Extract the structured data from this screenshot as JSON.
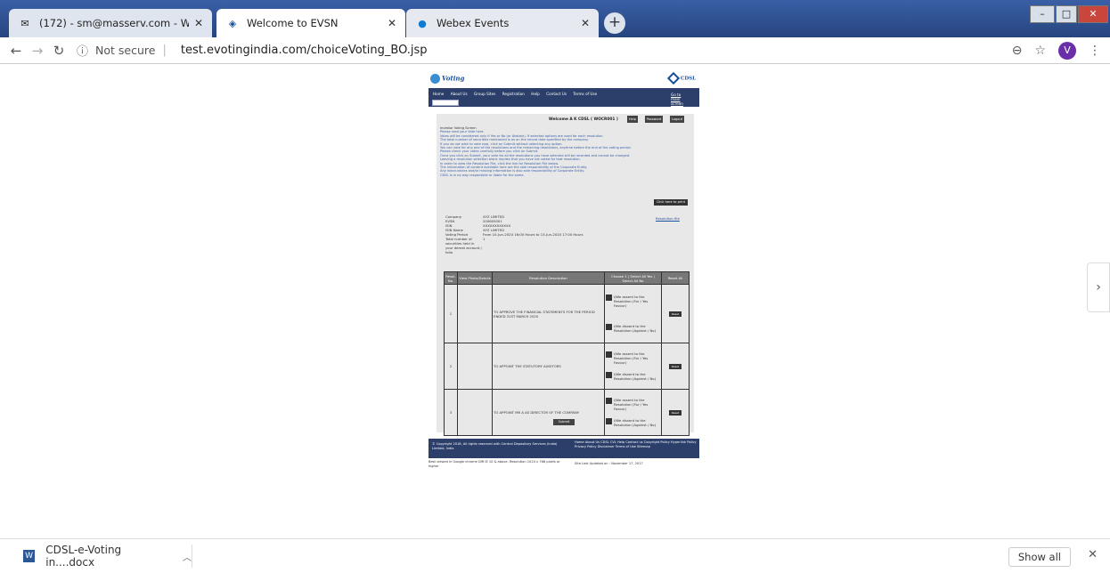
{
  "browser": {
    "tabs": [
      {
        "title": "(172) - sm@masserv.com - Web",
        "icon": "mail-icon"
      },
      {
        "title": "Welcome to EVSN",
        "icon": "cdsl-diamond-icon"
      },
      {
        "title": "Webex Events",
        "icon": "webex-icon"
      }
    ],
    "url_security": "Not secure",
    "url": "test.evotingindia.com/choiceVoting_BO.jsp",
    "profile_initial": "V"
  },
  "page": {
    "logo": "Voting",
    "brand": "CDSL",
    "nav_items": [
      "Home",
      "About Us",
      "Group Sites",
      "Registration",
      "Help",
      "Contact Us",
      "Terms of Use"
    ],
    "login_link": "Go to main screen",
    "welcome": "Welcome A K CDSL ( WOCR001 )",
    "top_buttons": [
      "Help",
      "Password",
      "Logout"
    ],
    "instructions_heading": "Investor Voting Screen",
    "instructions": [
      "Please read your Vote here.",
      "Votes will be considered only if Yes or No (or Abstain). If selected options are used for each resolution.",
      "The total number of securities mentioned is as on the record date specified by the company.",
      "If you do not wish to vote now, click on Submit without selecting any option.",
      "You can vote for any one of the resolutions and the remaining resolutions, anytime before the end of the voting period.",
      "Please check your votes carefully before you click on Submit.",
      "Once you click on Submit, your vote for all the resolutions you have selected will be recorded and cannot be changed.",
      "Leaving a resolution selection blank implies that you have not voted for that resolution.",
      "In order to view the Resolution File, click the link for Resolution File below.",
      "The information of content available here are the sole responsibility of the Corporate Entity.",
      "Any inaccuracies and/or missing information is also sole responsibility of Corporate Entity.",
      "CDSL is in no way responsible or liable for the same."
    ],
    "print_button": "Click here to print",
    "resolution_file": "Resolution file",
    "details": [
      {
        "key": "Company",
        "value": "XYZ LIMITED"
      },
      {
        "key": "EVSN",
        "value": "200605001"
      },
      {
        "key": "ISIN",
        "value": "XXXXXXXXXXXX"
      },
      {
        "key": "ISIN Name",
        "value": "XYZ LIMITED"
      },
      {
        "key": "Voting Period",
        "value": "From 10-Jun-2020 16:00 Hours to 13-Jun-2020 17:00 Hours"
      },
      {
        "key": "Total number of securities held in your demat account / folio",
        "value": "1"
      }
    ],
    "table_headers": [
      "Resol. No.",
      "View Photo/Details",
      "Resolution Description",
      "Choose 1 | Select All Yes | Select All No",
      "Reset All"
    ],
    "assent_yes": "I/We assent to the Resolution (For / Yes Favour)",
    "assent_no": "I/We dissent to the Resolution (Against / No)",
    "reset_label": "Reset",
    "resolutions": [
      {
        "no": "1",
        "description": "TO APPROVE THE FINANCIAL STATEMENTS FOR THE PERIOD ENDED 31ST MARCH 2020"
      },
      {
        "no": "2",
        "description": "TO APPOINT THE STATUTORY AUDITORS"
      },
      {
        "no": "3",
        "description": "TO APPOINT MR A AS DIRECTOR OF THE COMPANY"
      }
    ],
    "submit_button": "Submit",
    "footer_copyright": "© Copyright 2018, All rights reserved with Central Depository Services (India) Limited, India",
    "footer_links": "Home  About Us  CDSL  CVL  Help  Contact us  Copyright Policy  Hyperlink Policy  Privacy Policy  Disclaimer  Terms of Use  Sitemap",
    "bottom_left": "Best viewed in Google chrome DIR IE 10 & above. Resolution 1024 x 768 pixels or higher",
    "bottom_right": "Site Last Updated on : November 17, 2017"
  },
  "downloads": {
    "file": "CDSL-e-Voting in....docx",
    "show_all": "Show all"
  }
}
